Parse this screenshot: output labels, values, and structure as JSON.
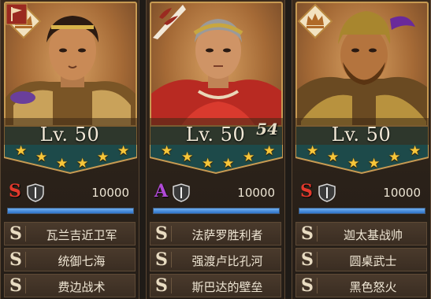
{
  "colors": {
    "accent_gold": "#c79a52",
    "star": "#f6c63a",
    "grade_S": "#e2392c",
    "grade_A": "#b04ad6",
    "progress": "#2e72c8"
  },
  "cards": [
    {
      "level": "Lv. 50",
      "tag": "",
      "badge_icon": "crown-icon",
      "extra_icon": "flag-icon",
      "stars": 6,
      "grade": "S",
      "power": "10000",
      "progress": 1.0,
      "skills": [
        {
          "grade": "S",
          "name": "瓦兰吉近卫军"
        },
        {
          "grade": "S",
          "name": "统御七海"
        },
        {
          "grade": "S",
          "name": "费边战术"
        }
      ]
    },
    {
      "level": "Lv. 50",
      "tag": "54",
      "badge_icon": "laurel-icon",
      "extra_icon": "",
      "stars": 6,
      "grade": "A",
      "power": "10000",
      "progress": 1.0,
      "skills": [
        {
          "grade": "S",
          "name": "法萨罗胜利者"
        },
        {
          "grade": "S",
          "name": "强渡卢比孔河"
        },
        {
          "grade": "S",
          "name": "斯巴达的壁垒"
        }
      ]
    },
    {
      "level": "Lv. 50",
      "tag": "",
      "badge_icon": "crown-icon",
      "extra_icon": "",
      "stars": 6,
      "grade": "S",
      "power": "10000",
      "progress": 1.0,
      "skills": [
        {
          "grade": "S",
          "name": "迦太基战帅"
        },
        {
          "grade": "S",
          "name": "圆桌武士"
        },
        {
          "grade": "S",
          "name": "黑色怒火"
        }
      ]
    }
  ]
}
